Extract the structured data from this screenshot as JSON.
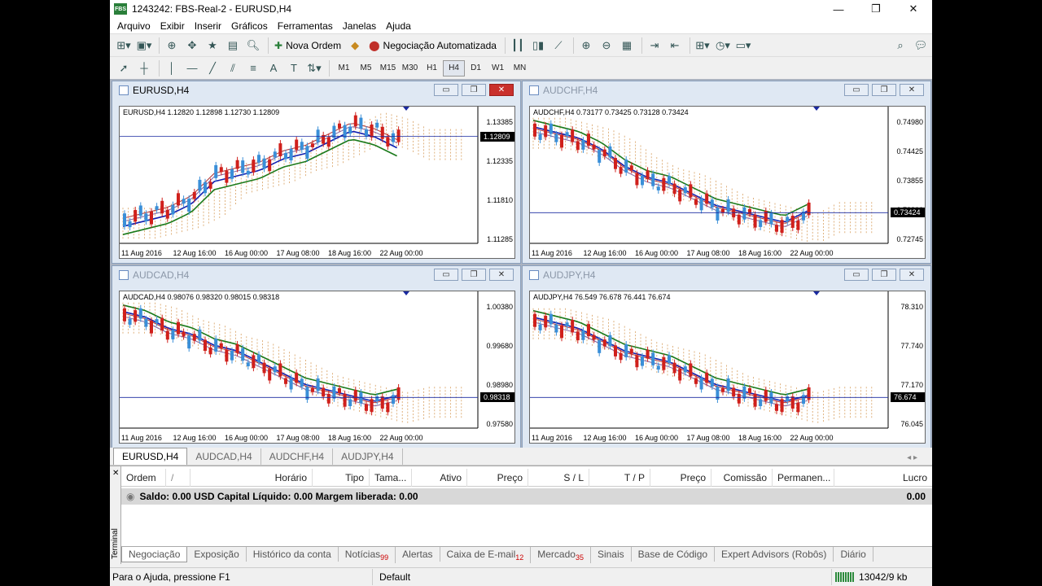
{
  "app": {
    "title": "1243242: FBS-Real-2 - EURUSD,H4",
    "logo_text": "FBS",
    "win_controls": [
      "—",
      "❐",
      "✕"
    ]
  },
  "menu": [
    "Arquivo",
    "Exibir",
    "Inserir",
    "Gráficos",
    "Ferramentas",
    "Janelas",
    "Ajuda"
  ],
  "toolbar": {
    "new_order": "Nova Ordem",
    "auto_trading": "Negociação Automatizada"
  },
  "timeframes": [
    "M1",
    "M5",
    "M15",
    "M30",
    "H1",
    "H4",
    "D1",
    "W1",
    "MN"
  ],
  "active_timeframe": "H4",
  "charts": [
    {
      "title": "EURUSD,H4",
      "info": "EURUSD,H4  1.12820 1.12898 1.12730 1.12809",
      "y_ticks": [
        "1.13385",
        "1.12335",
        "1.11810",
        "1.11285"
      ],
      "price_tag": "1.12809",
      "x_ticks": [
        "11 Aug 2016",
        "12 Aug 16:00",
        "16 Aug 00:00",
        "17 Aug 08:00",
        "18 Aug 16:00",
        "22 Aug 00:00"
      ],
      "active": true
    },
    {
      "title": "AUDCHF,H4",
      "info": "AUDCHF,H4  0.73177 0.73425 0.73128 0.73424",
      "y_ticks": [
        "0.74980",
        "0.74425",
        "0.73855",
        "0.73300",
        "0.72745"
      ],
      "price_tag": "0.73424",
      "x_ticks": [
        "11 Aug 2016",
        "12 Aug 16:00",
        "16 Aug 00:00",
        "17 Aug 08:00",
        "18 Aug 16:00",
        "22 Aug 00:00"
      ],
      "active": false
    },
    {
      "title": "AUDCAD,H4",
      "info": "AUDCAD,H4  0.98076 0.98320 0.98015 0.98318",
      "y_ticks": [
        "1.00380",
        "0.99680",
        "0.98980",
        "0.97580"
      ],
      "price_tag": "0.98318",
      "x_ticks": [
        "11 Aug 2016",
        "12 Aug 16:00",
        "16 Aug 00:00",
        "17 Aug 08:00",
        "18 Aug 16:00",
        "22 Aug 00:00"
      ],
      "active": false
    },
    {
      "title": "AUDJPY,H4",
      "info": "AUDJPY,H4  76.549 76.678 76.441 76.674",
      "y_ticks": [
        "78.310",
        "77.740",
        "77.170",
        "76.045"
      ],
      "price_tag": "76.674",
      "x_ticks": [
        "11 Aug 2016",
        "12 Aug 16:00",
        "16 Aug 00:00",
        "17 Aug 08:00",
        "18 Aug 16:00",
        "22 Aug 00:00"
      ],
      "active": false
    }
  ],
  "doc_tabs": [
    "EURUSD,H4",
    "AUDCAD,H4",
    "AUDCHF,H4",
    "AUDJPY,H4"
  ],
  "terminal": {
    "close": "✕",
    "side_label": "Terminal",
    "columns": [
      "Ordem",
      "/",
      "Horário",
      "Tipo",
      "Tama...",
      "Ativo",
      "Preço",
      "S / L",
      "T / P",
      "Preço",
      "Comissão",
      "Permanen...",
      "Lucro"
    ],
    "balance_text": "Saldo: 0.00 USD  Capital Líquido: 0.00  Margem liberada: 0.00",
    "balance_profit": "0.00",
    "tabs": [
      {
        "label": "Negociação",
        "badge": ""
      },
      {
        "label": "Exposição",
        "badge": ""
      },
      {
        "label": "Histórico da conta",
        "badge": ""
      },
      {
        "label": "Notícias",
        "badge": "99"
      },
      {
        "label": "Alertas",
        "badge": ""
      },
      {
        "label": "Caixa de E-mail",
        "badge": "12"
      },
      {
        "label": "Mercado",
        "badge": "35"
      },
      {
        "label": "Sinais",
        "badge": ""
      },
      {
        "label": "Base de Código",
        "badge": ""
      },
      {
        "label": "Expert Advisors (Robôs)",
        "badge": ""
      },
      {
        "label": "Diário",
        "badge": ""
      }
    ]
  },
  "status": {
    "help": "Para o Ajuda, pressione F1",
    "profile": "Default",
    "traffic": "13042/9 kb"
  },
  "colors": {
    "bull": "#3a8fd8",
    "bear": "#d0201c",
    "ma_fast": "#1020b0",
    "ma_slow": "#1b7a1b",
    "tenkan": "#b03030",
    "kijun": "#8060a0",
    "cloud": "#d8a060"
  }
}
